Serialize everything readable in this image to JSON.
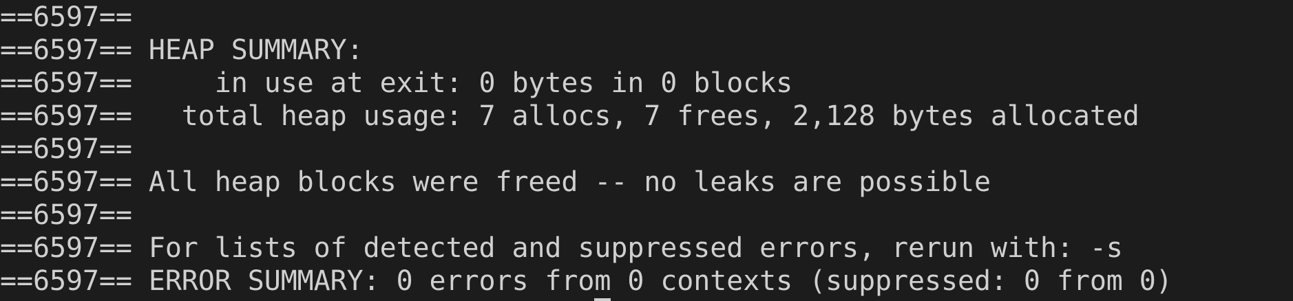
{
  "terminal": {
    "lines": [
      "==6597==",
      "==6597== HEAP SUMMARY:",
      "==6597==     in use at exit: 0 bytes in 0 blocks",
      "==6597==   total heap usage: 7 allocs, 7 frees, 2,128 bytes allocated",
      "==6597==",
      "==6597== All heap blocks were freed -- no leaks are possible",
      "==6597==",
      "==6597== For lists of detected and suppressed errors, rerun with: -s",
      "==6597== ERROR SUMMARY: 0 errors from 0 contexts (suppressed: 0 from 0)"
    ],
    "colors": {
      "background": "#1c1c1c",
      "foreground": "#d0d0d0"
    }
  }
}
